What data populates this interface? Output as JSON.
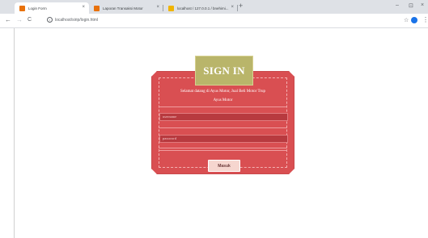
{
  "browser": {
    "tabs": [
      {
        "title": "Login Form",
        "active": true,
        "favicon_color": "#e8710a"
      },
      {
        "title": "Laporan Transaksi Motor",
        "active": false,
        "favicon_color": "#e8710a"
      },
      {
        "title": "localhost / 127.0.0.1 / bnehimi...",
        "active": false,
        "favicon_color": "#f0b400"
      }
    ],
    "new_tab": "+",
    "close": "×",
    "address": "localhost/sirip/login.html",
    "nav": {
      "back": "←",
      "forward": "→",
      "reload": "C"
    },
    "window": {
      "minimize": "–",
      "maximize": "⊡",
      "close": "×"
    }
  },
  "login": {
    "title": "SIGN IN",
    "welcome_line1": "Selamat datang di Ayus Motor, Jual Beli Motor Trup",
    "welcome_line2": "Ayus Motor",
    "username_placeholder": "username",
    "password_placeholder": "password",
    "submit_label": "Masuk",
    "colors": {
      "card": "#d94f52",
      "ribbon": "#b9b56a",
      "field": "#b83a3f",
      "button": "#f6d6cf"
    }
  }
}
